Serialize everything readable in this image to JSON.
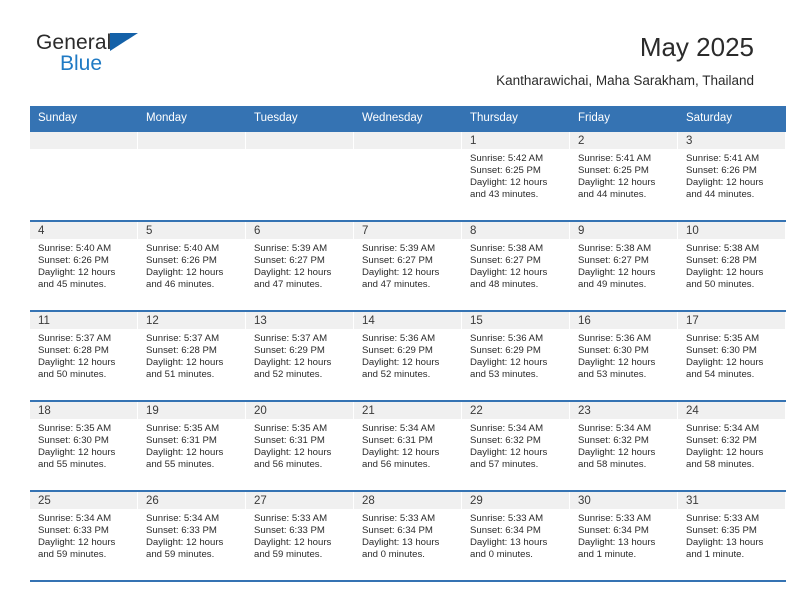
{
  "brand": {
    "name_top": "General",
    "name_bottom": "Blue",
    "triangle_icon": "triangle-icon",
    "color_top": "#2b2b2b",
    "color_bottom": "#1f7ac4"
  },
  "header": {
    "title": "May 2025",
    "subtitle": "Kantharawichai, Maha Sarakham, Thailand"
  },
  "theme": {
    "accent": "#3573b3",
    "date_band": "#f0f0f0",
    "text": "#2b2b2b"
  },
  "calendar": {
    "day_names": [
      "Sunday",
      "Monday",
      "Tuesday",
      "Wednesday",
      "Thursday",
      "Friday",
      "Saturday"
    ],
    "weeks": [
      [
        {
          "date": "",
          "empty": true
        },
        {
          "date": "",
          "empty": true
        },
        {
          "date": "",
          "empty": true
        },
        {
          "date": "",
          "empty": true
        },
        {
          "date": "1",
          "sunrise": "Sunrise: 5:42 AM",
          "sunset": "Sunset: 6:25 PM",
          "daylight_1": "Daylight: 12 hours",
          "daylight_2": "and 43 minutes."
        },
        {
          "date": "2",
          "sunrise": "Sunrise: 5:41 AM",
          "sunset": "Sunset: 6:25 PM",
          "daylight_1": "Daylight: 12 hours",
          "daylight_2": "and 44 minutes."
        },
        {
          "date": "3",
          "sunrise": "Sunrise: 5:41 AM",
          "sunset": "Sunset: 6:26 PM",
          "daylight_1": "Daylight: 12 hours",
          "daylight_2": "and 44 minutes."
        }
      ],
      [
        {
          "date": "4",
          "sunrise": "Sunrise: 5:40 AM",
          "sunset": "Sunset: 6:26 PM",
          "daylight_1": "Daylight: 12 hours",
          "daylight_2": "and 45 minutes."
        },
        {
          "date": "5",
          "sunrise": "Sunrise: 5:40 AM",
          "sunset": "Sunset: 6:26 PM",
          "daylight_1": "Daylight: 12 hours",
          "daylight_2": "and 46 minutes."
        },
        {
          "date": "6",
          "sunrise": "Sunrise: 5:39 AM",
          "sunset": "Sunset: 6:27 PM",
          "daylight_1": "Daylight: 12 hours",
          "daylight_2": "and 47 minutes."
        },
        {
          "date": "7",
          "sunrise": "Sunrise: 5:39 AM",
          "sunset": "Sunset: 6:27 PM",
          "daylight_1": "Daylight: 12 hours",
          "daylight_2": "and 47 minutes."
        },
        {
          "date": "8",
          "sunrise": "Sunrise: 5:38 AM",
          "sunset": "Sunset: 6:27 PM",
          "daylight_1": "Daylight: 12 hours",
          "daylight_2": "and 48 minutes."
        },
        {
          "date": "9",
          "sunrise": "Sunrise: 5:38 AM",
          "sunset": "Sunset: 6:27 PM",
          "daylight_1": "Daylight: 12 hours",
          "daylight_2": "and 49 minutes."
        },
        {
          "date": "10",
          "sunrise": "Sunrise: 5:38 AM",
          "sunset": "Sunset: 6:28 PM",
          "daylight_1": "Daylight: 12 hours",
          "daylight_2": "and 50 minutes."
        }
      ],
      [
        {
          "date": "11",
          "sunrise": "Sunrise: 5:37 AM",
          "sunset": "Sunset: 6:28 PM",
          "daylight_1": "Daylight: 12 hours",
          "daylight_2": "and 50 minutes."
        },
        {
          "date": "12",
          "sunrise": "Sunrise: 5:37 AM",
          "sunset": "Sunset: 6:28 PM",
          "daylight_1": "Daylight: 12 hours",
          "daylight_2": "and 51 minutes."
        },
        {
          "date": "13",
          "sunrise": "Sunrise: 5:37 AM",
          "sunset": "Sunset: 6:29 PM",
          "daylight_1": "Daylight: 12 hours",
          "daylight_2": "and 52 minutes."
        },
        {
          "date": "14",
          "sunrise": "Sunrise: 5:36 AM",
          "sunset": "Sunset: 6:29 PM",
          "daylight_1": "Daylight: 12 hours",
          "daylight_2": "and 52 minutes."
        },
        {
          "date": "15",
          "sunrise": "Sunrise: 5:36 AM",
          "sunset": "Sunset: 6:29 PM",
          "daylight_1": "Daylight: 12 hours",
          "daylight_2": "and 53 minutes."
        },
        {
          "date": "16",
          "sunrise": "Sunrise: 5:36 AM",
          "sunset": "Sunset: 6:30 PM",
          "daylight_1": "Daylight: 12 hours",
          "daylight_2": "and 53 minutes."
        },
        {
          "date": "17",
          "sunrise": "Sunrise: 5:35 AM",
          "sunset": "Sunset: 6:30 PM",
          "daylight_1": "Daylight: 12 hours",
          "daylight_2": "and 54 minutes."
        }
      ],
      [
        {
          "date": "18",
          "sunrise": "Sunrise: 5:35 AM",
          "sunset": "Sunset: 6:30 PM",
          "daylight_1": "Daylight: 12 hours",
          "daylight_2": "and 55 minutes."
        },
        {
          "date": "19",
          "sunrise": "Sunrise: 5:35 AM",
          "sunset": "Sunset: 6:31 PM",
          "daylight_1": "Daylight: 12 hours",
          "daylight_2": "and 55 minutes."
        },
        {
          "date": "20",
          "sunrise": "Sunrise: 5:35 AM",
          "sunset": "Sunset: 6:31 PM",
          "daylight_1": "Daylight: 12 hours",
          "daylight_2": "and 56 minutes."
        },
        {
          "date": "21",
          "sunrise": "Sunrise: 5:34 AM",
          "sunset": "Sunset: 6:31 PM",
          "daylight_1": "Daylight: 12 hours",
          "daylight_2": "and 56 minutes."
        },
        {
          "date": "22",
          "sunrise": "Sunrise: 5:34 AM",
          "sunset": "Sunset: 6:32 PM",
          "daylight_1": "Daylight: 12 hours",
          "daylight_2": "and 57 minutes."
        },
        {
          "date": "23",
          "sunrise": "Sunrise: 5:34 AM",
          "sunset": "Sunset: 6:32 PM",
          "daylight_1": "Daylight: 12 hours",
          "daylight_2": "and 58 minutes."
        },
        {
          "date": "24",
          "sunrise": "Sunrise: 5:34 AM",
          "sunset": "Sunset: 6:32 PM",
          "daylight_1": "Daylight: 12 hours",
          "daylight_2": "and 58 minutes."
        }
      ],
      [
        {
          "date": "25",
          "sunrise": "Sunrise: 5:34 AM",
          "sunset": "Sunset: 6:33 PM",
          "daylight_1": "Daylight: 12 hours",
          "daylight_2": "and 59 minutes."
        },
        {
          "date": "26",
          "sunrise": "Sunrise: 5:34 AM",
          "sunset": "Sunset: 6:33 PM",
          "daylight_1": "Daylight: 12 hours",
          "daylight_2": "and 59 minutes."
        },
        {
          "date": "27",
          "sunrise": "Sunrise: 5:33 AM",
          "sunset": "Sunset: 6:33 PM",
          "daylight_1": "Daylight: 12 hours",
          "daylight_2": "and 59 minutes."
        },
        {
          "date": "28",
          "sunrise": "Sunrise: 5:33 AM",
          "sunset": "Sunset: 6:34 PM",
          "daylight_1": "Daylight: 13 hours",
          "daylight_2": "and 0 minutes."
        },
        {
          "date": "29",
          "sunrise": "Sunrise: 5:33 AM",
          "sunset": "Sunset: 6:34 PM",
          "daylight_1": "Daylight: 13 hours",
          "daylight_2": "and 0 minutes."
        },
        {
          "date": "30",
          "sunrise": "Sunrise: 5:33 AM",
          "sunset": "Sunset: 6:34 PM",
          "daylight_1": "Daylight: 13 hours",
          "daylight_2": "and 1 minute."
        },
        {
          "date": "31",
          "sunrise": "Sunrise: 5:33 AM",
          "sunset": "Sunset: 6:35 PM",
          "daylight_1": "Daylight: 13 hours",
          "daylight_2": "and 1 minute."
        }
      ]
    ]
  }
}
